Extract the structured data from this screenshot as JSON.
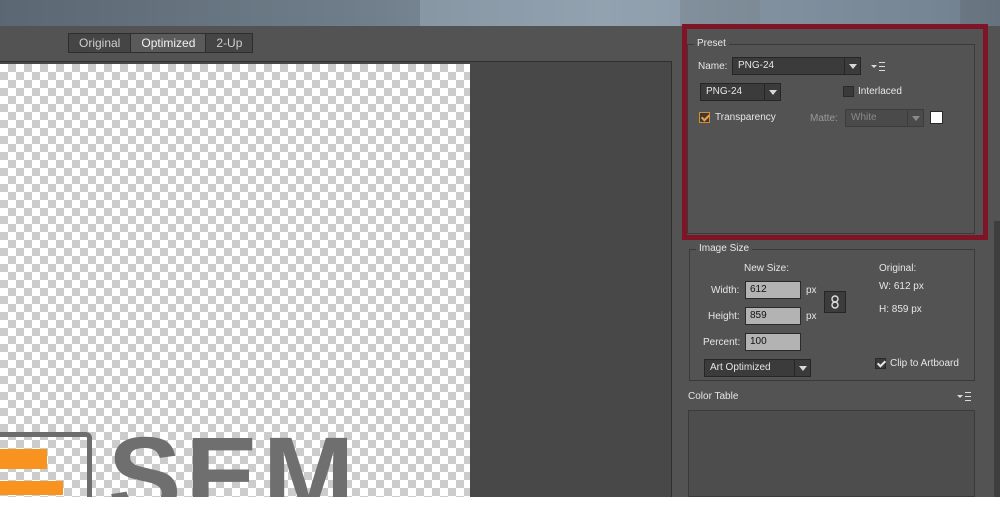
{
  "view_tabs": [
    {
      "label": "Original",
      "active": false
    },
    {
      "label": "Optimized",
      "active": true
    },
    {
      "label": "2-Up",
      "active": false
    }
  ],
  "preset": {
    "title": "Preset",
    "name_label": "Name:",
    "name_value": "PNG-24",
    "format_value": "PNG-24",
    "interlaced_label": "Interlaced",
    "interlaced_checked": false,
    "transparency_label": "Transparency",
    "transparency_checked": true,
    "matte_label": "Matte:",
    "matte_value": "White",
    "matte_color": "#ffffff"
  },
  "image_size": {
    "title": "Image Size",
    "new_size_label": "New Size:",
    "width_label": "Width:",
    "width_value": "612",
    "height_label": "Height:",
    "height_value": "859",
    "percent_label": "Percent:",
    "percent_value": "100",
    "unit_px": "px",
    "original_label": "Original:",
    "original_w": "W:   612 px",
    "original_h": "H:   859 px",
    "quality_value": "Art Optimized",
    "clip_label": "Clip to Artboard",
    "clip_checked": true
  },
  "color_table": {
    "title": "Color Table"
  },
  "logo": {
    "letters": "SEM",
    "accent_color": "#f7931e",
    "gray_color": "#6f6f6f"
  },
  "highlight_color": "#7e1426"
}
